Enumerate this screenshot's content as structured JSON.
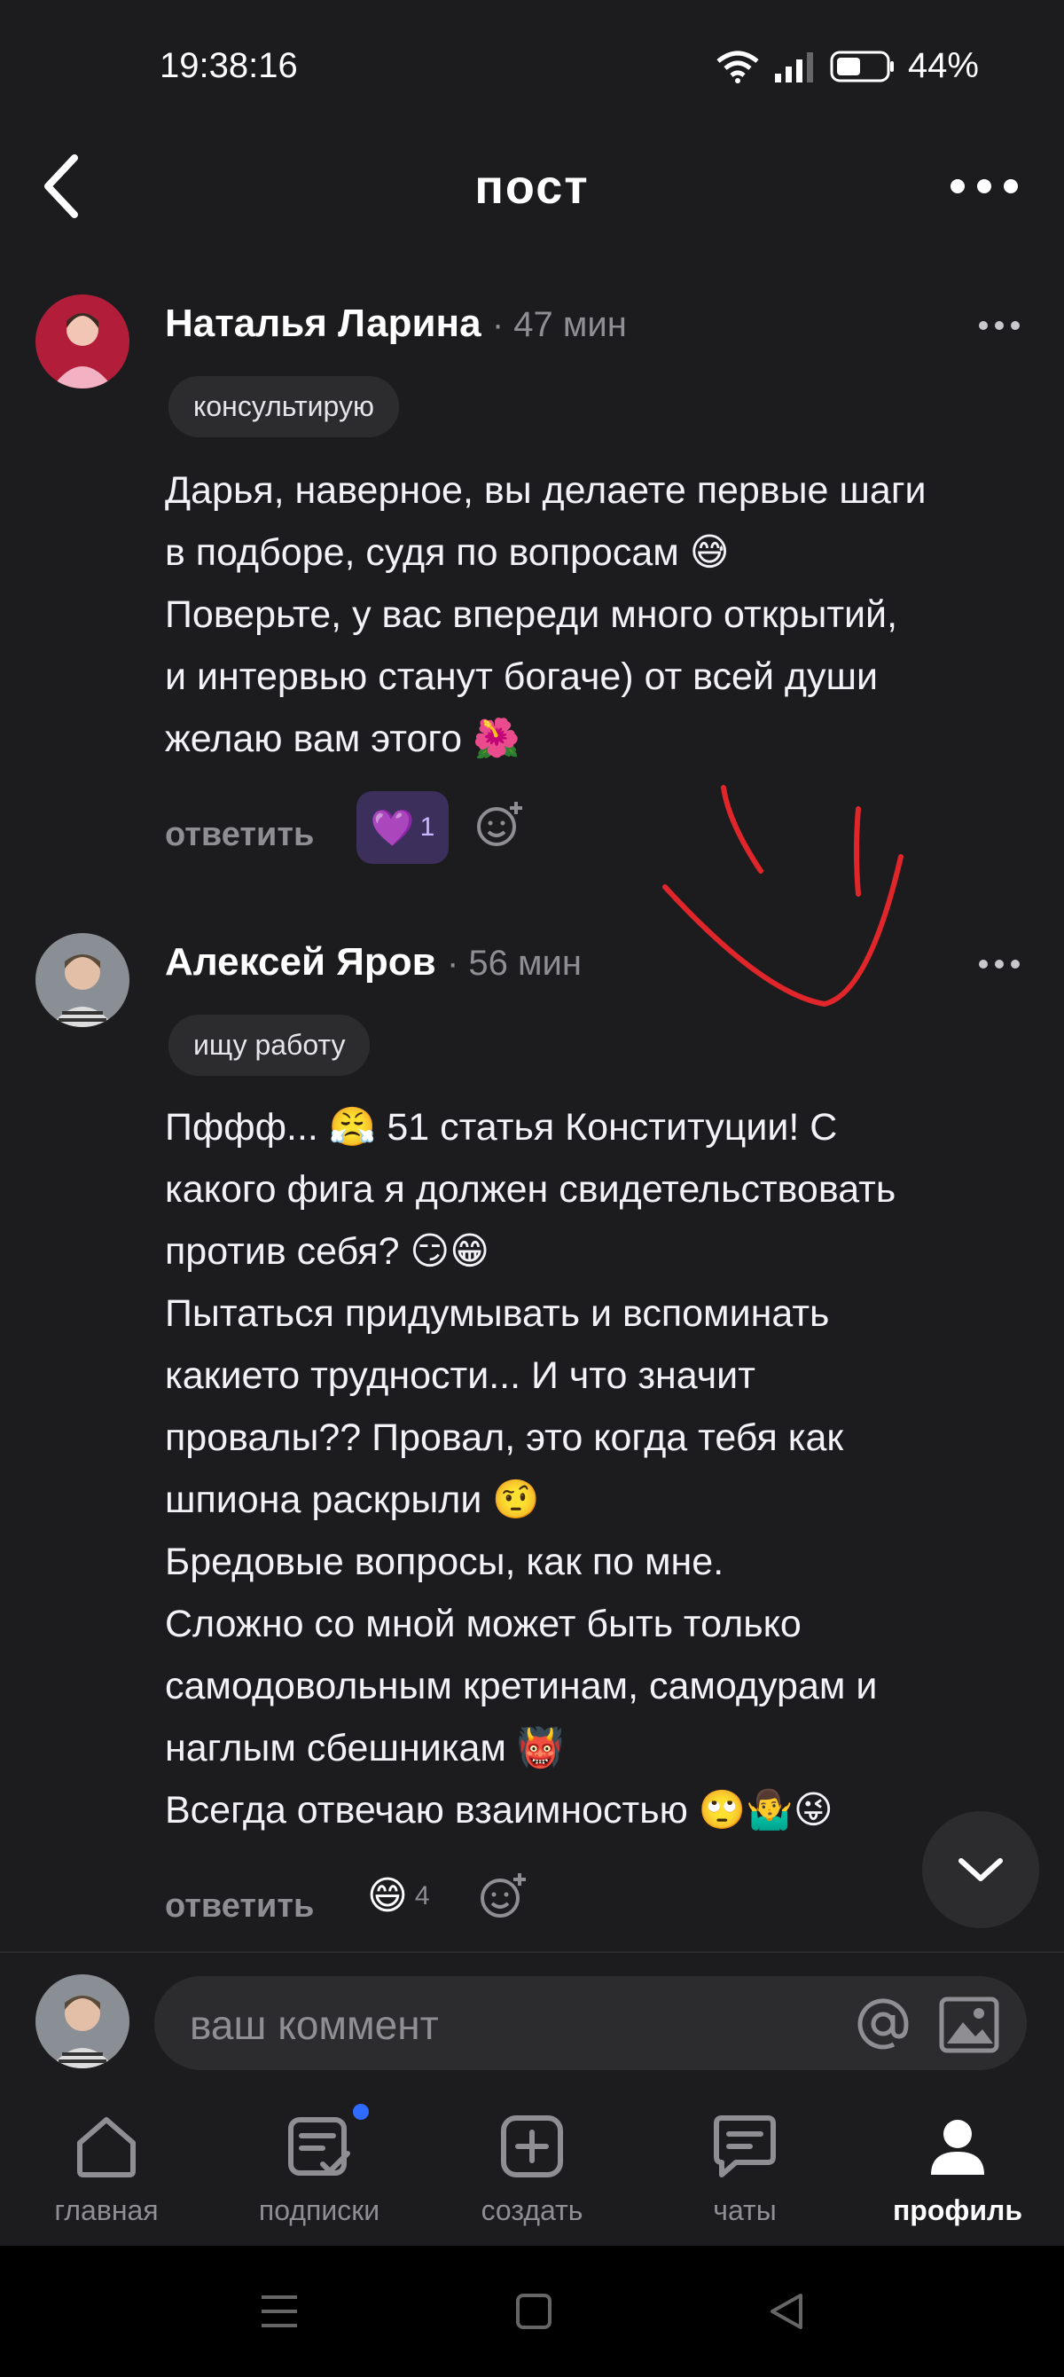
{
  "status_bar": {
    "time": "19:38:16",
    "battery": "44%"
  },
  "header": {
    "title": "пост"
  },
  "comments": [
    {
      "author": "Наталья Ларина",
      "time": "· 47 мин",
      "tag": "консультирую",
      "lines": [
        "Дарья, наверное, вы делаете первые шаги",
        "в подборе, судя по вопросам 😅",
        "Поверьте, у вас впереди много открытий,",
        "и интервью станут богаче) от всей души",
        "желаю вам этого 🌺"
      ],
      "reply_label": "ответить",
      "reaction": {
        "emoji": "💜",
        "count": "1"
      }
    },
    {
      "author": "Алексей Яров",
      "time": "· 56 мин",
      "tag": "ищу работу",
      "lines": [
        "Пффф... 😤 51 статья Конституции! С",
        "какого фига я должен свидетельствовать",
        "против себя? 😏😁",
        "Пытаться придумывать и вспоминать",
        "какието трудности... И что значит",
        "провалы?? Провал, это когда тебя как",
        "шпиона раскрыли 🤨",
        "Бредовые вопросы, как по мне.",
        "Сложно со мной может быть только",
        "самодовольным кретинам, самодурам и",
        "наглым сбешникам 👹",
        "Всегда отвечаю взаимностью 🙄🤷‍♂️😜"
      ],
      "reply_label": "ответить",
      "reaction": {
        "emoji": "😄",
        "count": "4"
      }
    }
  ],
  "comment_input": {
    "placeholder": "ваш коммент"
  },
  "nav": [
    {
      "label": "главная",
      "icon": "home-icon"
    },
    {
      "label": "подписки",
      "icon": "subscriptions-icon"
    },
    {
      "label": "создать",
      "icon": "create-icon"
    },
    {
      "label": "чаты",
      "icon": "chat-icon"
    },
    {
      "label": "профиль",
      "icon": "profile-icon",
      "active": true
    }
  ],
  "colors": {
    "background": "#1c1c1e",
    "reaction_bg": "#3d2f5c",
    "annotation": "#e0262a",
    "notify_dot": "#2f6bff"
  }
}
